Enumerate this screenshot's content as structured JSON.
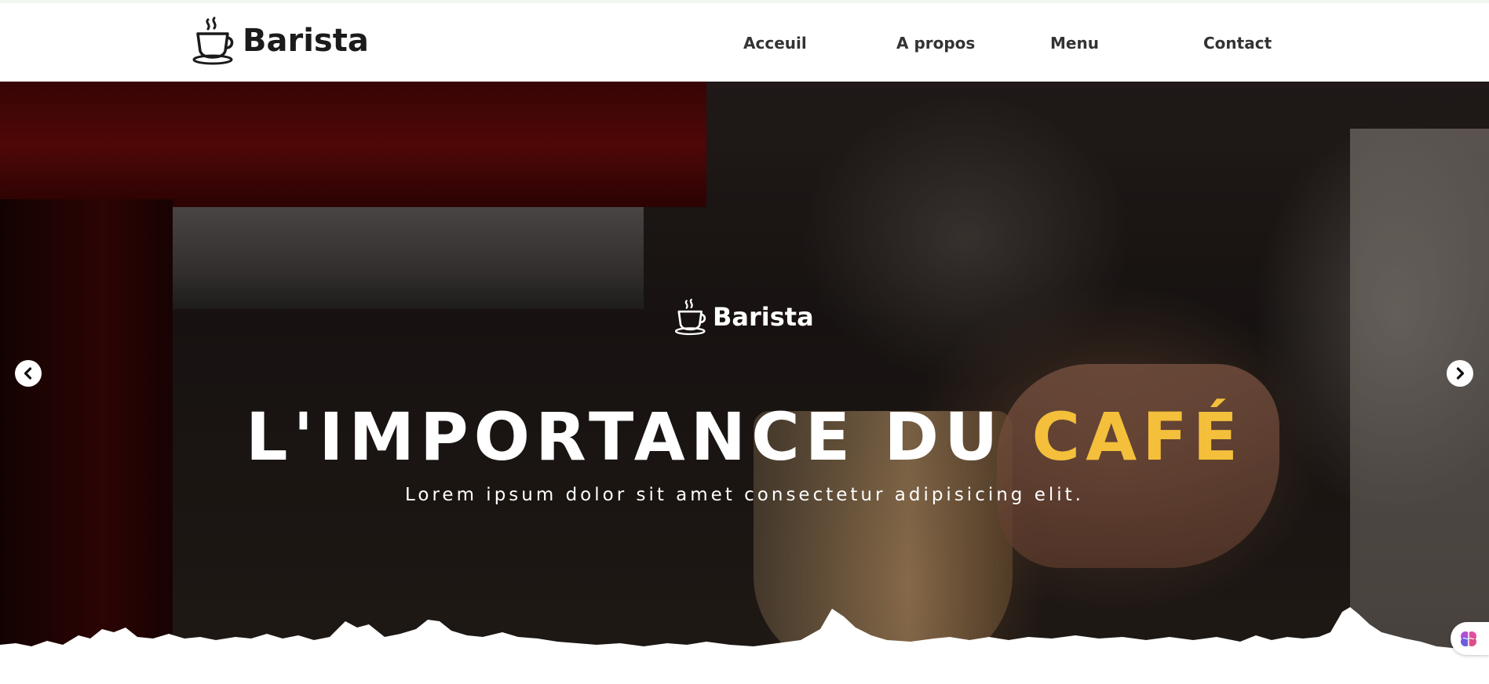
{
  "header": {
    "brand": "Barista",
    "logo_icon": "coffee-cup-icon",
    "nav": [
      {
        "label": "Acceuil"
      },
      {
        "label": "A propos"
      },
      {
        "label": "Menu"
      },
      {
        "label": "Contact"
      }
    ]
  },
  "hero": {
    "brand": "Barista",
    "logo_icon": "coffee-cup-icon",
    "title_main": "L'IMPORTANCE DU ",
    "title_accent": "CAFÉ",
    "subtitle": "Lorem ipsum dolor sit amet consectetur adipisicing elit.",
    "prev_icon": "chevron-left-icon",
    "next_icon": "chevron-right-icon"
  },
  "colors": {
    "accent": "#f4bf3b",
    "text_dark": "#333333",
    "brand_dark": "#1b1b1b",
    "white": "#ffffff"
  },
  "widget": {
    "icon": "brain-icon"
  }
}
